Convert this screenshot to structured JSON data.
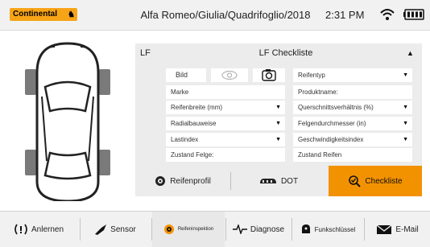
{
  "header": {
    "brand": "Continental",
    "vehicle": "Alfa Romeo/Giulia/Quadrifoglio/2018",
    "time": "2:31 PM",
    "wifi_icon": "wifi-icon",
    "battery_icon": "battery-icon"
  },
  "panel": {
    "position": "LF",
    "title": "LF Checkliste",
    "bild_label": "Bild",
    "fields": {
      "reifentyp": "Reifentyp",
      "marke": "Marke",
      "produktname": "Produktname:",
      "reifenbreite": "Reifenbreite (mm)",
      "querschnitt": "Querschnittsverhältnis (%)",
      "radialbauweise": "Radialbauweise",
      "felgendurchmesser": "Felgendurchmesser (in)",
      "lastindex": "Lastindex",
      "geschwindigkeitsindex": "Geschwindigkeitsindex",
      "zustand_felge": "Zustand Felge:",
      "zustand_reifen": "Zustand Reifen"
    }
  },
  "tabs": [
    {
      "label": "Reifenprofil",
      "icon": "tire-icon"
    },
    {
      "label": "DOT",
      "icon": "dot-icon"
    },
    {
      "label": "Checkliste",
      "icon": "checklist-icon"
    }
  ],
  "nav": [
    {
      "label": "Anlernen",
      "icon": "learn-icon"
    },
    {
      "label": "Sensor",
      "icon": "sensor-icon"
    },
    {
      "label": "Reifeninspektion",
      "icon": "tire-inspection-icon"
    },
    {
      "label": "Diagnose",
      "icon": "diagnose-icon"
    },
    {
      "label": "Funkschlüssel",
      "icon": "key-fob-icon"
    },
    {
      "label": "E-Mail",
      "icon": "email-icon"
    }
  ],
  "colors": {
    "accent": "#f39200",
    "brand": "#f8a417",
    "panel_bg": "#ececec"
  }
}
